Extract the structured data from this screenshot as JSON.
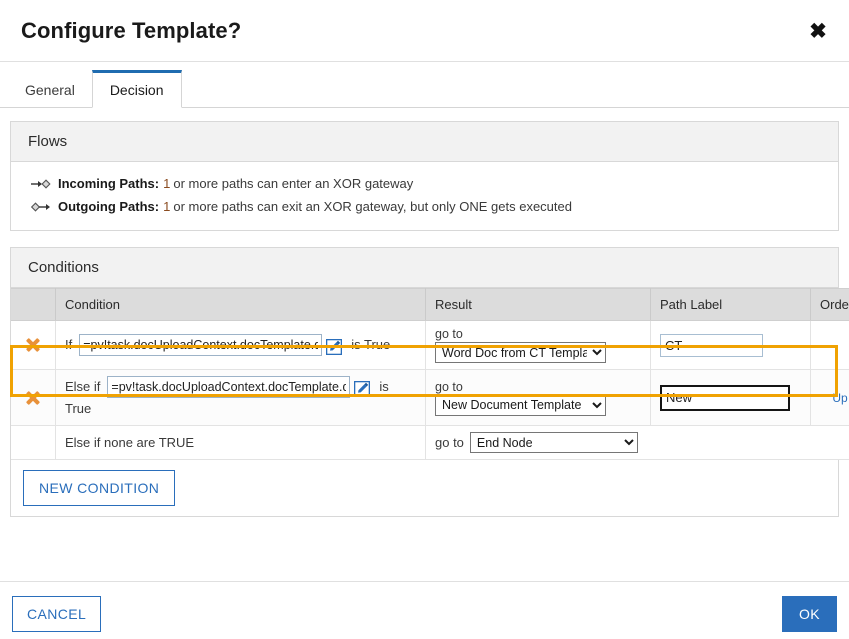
{
  "dialog": {
    "title": "Configure Template?",
    "close_icon": "close-icon"
  },
  "tabs": [
    {
      "label": "General",
      "active": false
    },
    {
      "label": "Decision",
      "active": true
    }
  ],
  "flows": {
    "heading": "Flows",
    "rows": [
      {
        "icon": "incoming-path-icon",
        "label": "Incoming Paths:",
        "number": "1",
        "text": "or more paths can enter an XOR gateway"
      },
      {
        "icon": "outgoing-path-icon",
        "label": "Outgoing Paths:",
        "number": "1",
        "text": "or more paths can exit an XOR gateway, but only ONE gets executed"
      }
    ]
  },
  "conditions": {
    "heading": "Conditions",
    "columns": {
      "actions": "",
      "condition": "Condition",
      "result": "Result",
      "path_label": "Path Label",
      "order": "Order"
    },
    "rows": [
      {
        "delete_icon": "delete-icon",
        "keyword": "If",
        "expression": "=pv!task.docUploadContext.docTemplate.docur",
        "edit_icon": "edit-icon",
        "suffix": "is True",
        "wrap_text": "",
        "goto_label": "go to",
        "node": "Word Doc from CT Template",
        "path_label": "CT",
        "order": "",
        "highlighted": false,
        "focused": false
      },
      {
        "delete_icon": "delete-icon",
        "keyword": "Else if",
        "expression": "=pv!task.docUploadContext.docTemplate.docur",
        "edit_icon": "edit-icon",
        "suffix": "is",
        "wrap_text": "True",
        "goto_label": "go to",
        "node": "New Document Template",
        "path_label": "New",
        "order": "Up",
        "highlighted": true,
        "focused": true
      }
    ],
    "default_row": {
      "text": "Else if none are TRUE",
      "goto_label": "go to",
      "node": "End Node"
    },
    "new_condition_label": "NEW CONDITION"
  },
  "footer": {
    "cancel_label": "CANCEL",
    "ok_label": "OK"
  },
  "colors": {
    "accent_blue": "#2a6ebb",
    "highlight_orange": "#f0a202",
    "delete_orange": "#e8913a",
    "header_grey": "#dcdcdc"
  }
}
